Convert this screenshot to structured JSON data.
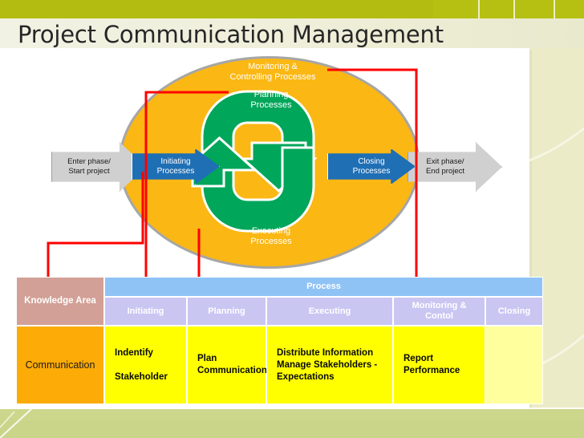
{
  "slide": {
    "title": "Project Communication Management"
  },
  "diagram": {
    "ellipse_label": "Monitoring &\nControlling Processes",
    "planning_label": "Planning\nProcesses",
    "executing_label": "Executing\nProcesses",
    "initiating_label": "Initiating\nProcesses",
    "closing_label": "Closing\nProcesses",
    "enter_label": "Enter phase/\nStart project",
    "exit_label": "Exit phase/\nEnd project",
    "colors": {
      "ellipse": "#fbb713",
      "ellipse_border": "#a6a6a6",
      "loop": "#00a65a",
      "blue_arrow": "#1f6fb5",
      "gray_arrow": "#d0d0d0",
      "connector": "#ff0000"
    }
  },
  "table": {
    "knowledge_area_header": "Knowledge Area",
    "process_header": "Process",
    "sub_headers": [
      "Initiating",
      "Planning",
      "Executing",
      "Monitoring &\nContol",
      "Closing"
    ],
    "rows": [
      {
        "area": "Communication",
        "cells": [
          "Indentify\n\nStakeholder",
          "Plan\nCommunication",
          "Distribute Information\nManage Stakeholders -\nExpectations",
          "Report\nPerformance",
          ""
        ]
      }
    ],
    "colors": {
      "knowledge_area_header": "#d2a096",
      "process_header": "#8fc3f5",
      "sub_header": "#c9c6f2",
      "area_cell": "#fcab07",
      "value_cell": "#ffff00",
      "empty_cell": "#ffff9e"
    }
  },
  "theme": {
    "band": "#b3bd11",
    "page_bg": "#ecebc8",
    "panel": "#ffffff",
    "footer": "#cdd78c"
  }
}
